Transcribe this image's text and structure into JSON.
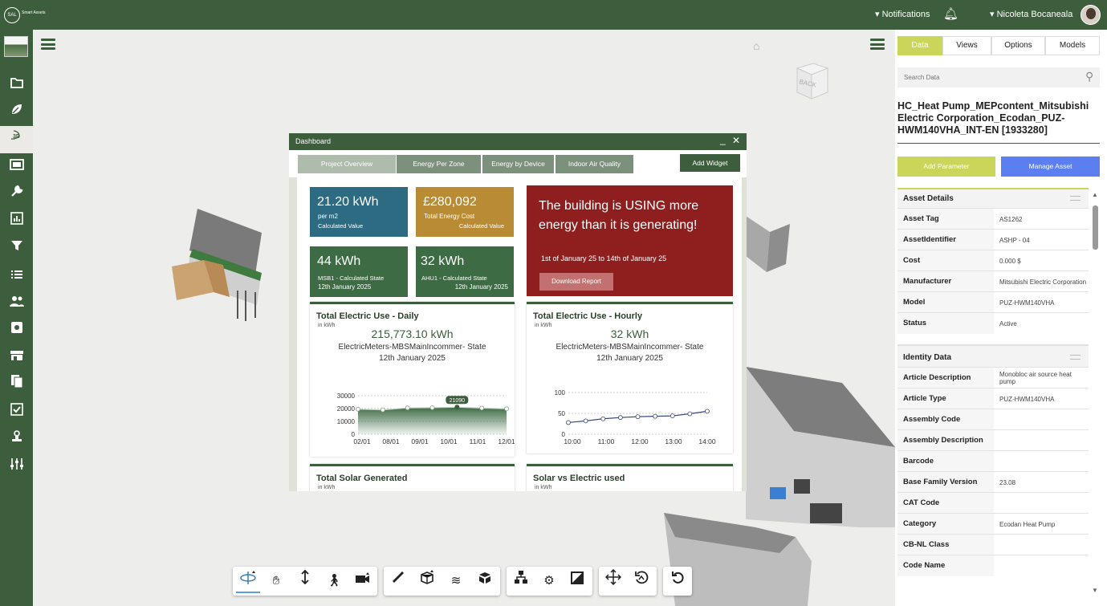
{
  "header": {
    "logo_text": "Smart Assets",
    "notifications_label": "Notifications",
    "user_name": "Nicoleta Bocaneala"
  },
  "sidebar": {
    "icons": [
      "folder-icon",
      "leaf-icon",
      "3d-icon",
      "window-icon",
      "wrench-icon",
      "chart-icon",
      "filter-icon",
      "list-icon",
      "users-icon",
      "gear-icon",
      "store-icon",
      "document-icon",
      "checklist-icon",
      "stamp-icon",
      "sliders-icon"
    ],
    "active_index": 2,
    "3d_label": "3D"
  },
  "viewport": {
    "viewcube_label": "BACK"
  },
  "dashboard": {
    "title": "Dashboard",
    "tabs": [
      "Project Overview",
      "Energy Per Zone",
      "Energy by Device",
      "Indoor Air Quality"
    ],
    "add_widget": "Add Widget",
    "kpis": [
      {
        "value": "21.20 kWh",
        "sub": "per m2",
        "caption": "Calculated Value",
        "color": "#2c6b82"
      },
      {
        "value": "£280,092",
        "sub": "Total Energy Cost",
        "caption": "Calculated Value",
        "color": "#b98b35"
      },
      {
        "value": "44 kWh",
        "sub": "MSB1 - Calculated State",
        "caption": "12th January 2025",
        "color": "#3d6b44"
      },
      {
        "value": "32 kWh",
        "sub": "AHU1 - Calculated State",
        "caption": "12th January 2025",
        "color": "#3d6b44"
      }
    ],
    "alert": {
      "message": "The building is USING more energy than it is generating!",
      "date_range": "1st of January 25 to 14th of January 25",
      "button": "Download Report"
    },
    "daily": {
      "title": "Total Electric Use - Daily",
      "unit": "in kWh",
      "value": "215,773.10 kWh",
      "label": "ElectricMeters-MBSMainIncommer- State",
      "date": "12th January 2025"
    },
    "hourly": {
      "title": "Total Electric Use - Hourly",
      "unit": "in kWh",
      "value": "32 kWh",
      "label": "ElectricMeters-MBSMainIncommer- State",
      "date": "12th January 2025"
    },
    "solar": {
      "title": "Total Solar Generated",
      "unit": "in kWh"
    },
    "solar_vs": {
      "title": "Solar vs Electric used",
      "unit": "in kWh"
    }
  },
  "chart_data": [
    {
      "type": "area",
      "x": [
        "02/01",
        "",
        "08/01",
        "09/01",
        "10/01",
        "11/01",
        "12/01"
      ],
      "values": [
        19500,
        19000,
        20500,
        20700,
        21090,
        20400,
        19800
      ],
      "ylim": [
        0,
        30000
      ],
      "yticks": [
        0,
        10000,
        20000,
        30000
      ],
      "yticklabels": [
        "0",
        "10000",
        "20000",
        "30000"
      ],
      "xticklabels": [
        "02/01",
        "08/01",
        "09/01",
        "10/01",
        "11/01",
        "12/01"
      ],
      "highlight_label": "21090",
      "color": "#3d6b44"
    },
    {
      "type": "line",
      "x": [
        "10:00",
        "10:30",
        "11:00",
        "11:30",
        "12:00",
        "12:30",
        "13:00",
        "13:30",
        "14:00"
      ],
      "values": [
        28,
        32,
        37,
        40,
        42,
        43,
        44,
        49,
        55
      ],
      "ylim": [
        0,
        100
      ],
      "yticks": [
        0,
        50,
        100
      ],
      "yticklabels": [
        "0",
        "50",
        "100"
      ],
      "xticklabels": [
        "10:00",
        "11:00",
        "12:00",
        "13:00",
        "14:00"
      ],
      "color": "#3b4b7a"
    }
  ],
  "panel": {
    "tabs": [
      "Data",
      "Views",
      "Options",
      "Models"
    ],
    "active_tab": 0,
    "search_placeholder": "Search Data",
    "asset_title": "HC_Heat Pump_MEPcontent_Mitsubishi Electric Corporation_Ecodan_PUZ-HWM140VHA_INT-EN [1933280]",
    "add_parameter": "Add Parameter",
    "manage_asset": "Manage Asset",
    "asset_details": {
      "title": "Asset Details",
      "rows": [
        {
          "k": "Asset Tag",
          "v": "AS1262"
        },
        {
          "k": "AssetIdentifier",
          "v": "ASHP - 04"
        },
        {
          "k": "Cost",
          "v": "0.000 $"
        },
        {
          "k": "Manufacturer",
          "v": "Mitsubishi Electric Corporation"
        },
        {
          "k": "Model",
          "v": "PUZ-HWM140VHA"
        },
        {
          "k": "Status",
          "v": "Active"
        }
      ]
    },
    "identity_data": {
      "title": "Identity Data",
      "rows": [
        {
          "k": "Article Description",
          "v": "Monobloc air source heat pump"
        },
        {
          "k": "Article Type",
          "v": "PUZ-HWM140VHA"
        },
        {
          "k": "Assembly Code",
          "v": ""
        },
        {
          "k": "Assembly Description",
          "v": ""
        },
        {
          "k": "Barcode",
          "v": ""
        },
        {
          "k": "Base Family Version",
          "v": "23.08"
        },
        {
          "k": "CAT Code",
          "v": ""
        },
        {
          "k": "Category",
          "v": "Ecodan Heat Pump"
        },
        {
          "k": "CB-NL Class",
          "v": ""
        },
        {
          "k": "Code Name",
          "v": ""
        }
      ]
    }
  },
  "toolbar": {
    "groups": [
      [
        "orbit-icon",
        "pan-hand-icon",
        "zoom-arrows-icon",
        "walk-icon",
        "camera-icon"
      ],
      [
        "measure-ruler-icon",
        "section-box-icon",
        "explode-icon",
        "model-cube-icon"
      ],
      [
        "tree-icon",
        "settings-icon",
        "properties-icon"
      ],
      [
        "move-icon",
        "reset-view-icon"
      ],
      [
        "undo-icon"
      ]
    ]
  }
}
